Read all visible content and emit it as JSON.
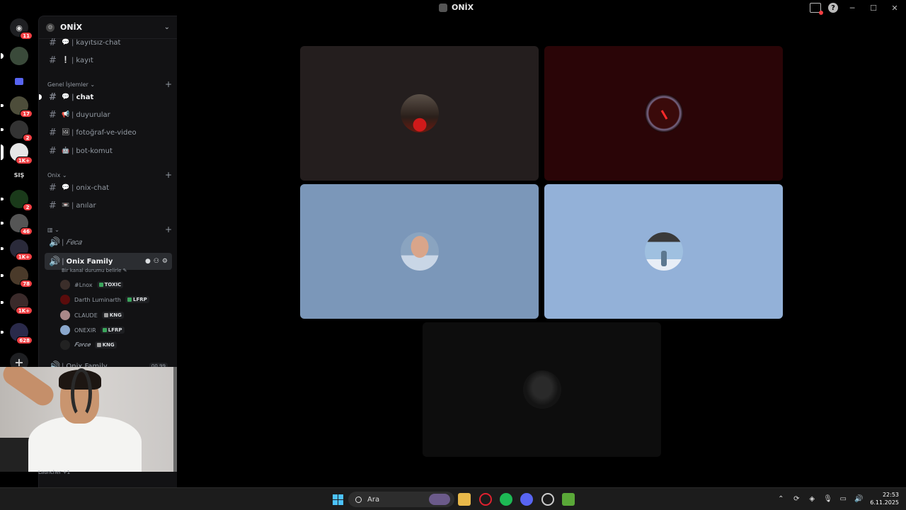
{
  "window": {
    "title": "ONİX"
  },
  "rail": {
    "badges": [
      "11",
      "17",
      "2",
      "1K+",
      "2",
      "46",
      "1K+",
      "78",
      "1K+",
      "628"
    ],
    "text_server": "SIŞ"
  },
  "guild": {
    "name": "ONİX"
  },
  "channels": {
    "top": [
      {
        "emoji": "💬",
        "name": "kayıtsız-chat"
      },
      {
        "emoji": "❕",
        "name": "kayıt"
      }
    ],
    "category1": "Genel İşlemler",
    "cat1_items": [
      {
        "emoji": "💬",
        "name": "chat"
      },
      {
        "emoji": "📢",
        "name": "duyurular"
      },
      {
        "emoji": "🖼",
        "name": "fotoğraf-ve-video"
      },
      {
        "emoji": "🤖",
        "name": "bot-komut"
      }
    ],
    "category2": "Onix",
    "cat2_items": [
      {
        "emoji": "💬",
        "name": "onix-chat"
      },
      {
        "emoji": "📼",
        "name": "anılar"
      }
    ],
    "category3": "",
    "voice1": "𝐹𝑒𝑐𝑎",
    "voice2": "Onix Family",
    "voice2_status": "Bir kanal durumu belirle",
    "voice3": "Onix Family",
    "voice3_count": "00",
    "voice3_limit": "99"
  },
  "members": [
    {
      "name": "#Lnox",
      "tag": "TOXIC",
      "tag_color": "#3ba55c"
    },
    {
      "name": "Darth Luminarth",
      "tag": "LFRP",
      "tag_color": "#3ba55c"
    },
    {
      "name": "CLAUDE",
      "tag": "KNG",
      "tag_color": "#9e9e9e"
    },
    {
      "name": "ONEXIR",
      "tag": "LFRP",
      "tag_color": "#3ba55c"
    },
    {
      "name": "𝑭𝒐𝒓𝒄𝒆",
      "tag": "KNG",
      "tag_color": "#9e9e9e"
    }
  ],
  "launcher_text": "Launcher +1",
  "stage_tiles": [
    {
      "bg": "#241e1e",
      "avatar": "night-silhouette"
    },
    {
      "bg": "#2a0507",
      "avatar": "red-lightsaber"
    },
    {
      "bg": "#7b97b9",
      "avatar": "older-man"
    },
    {
      "bg": "#93b1d8",
      "avatar": "snow-figure"
    },
    {
      "bg": "#0d0d0d",
      "avatar": "dark-figure"
    }
  ],
  "taskbar": {
    "search_placeholder": "Ara",
    "time": "22:53",
    "date": "6.11.2025"
  }
}
